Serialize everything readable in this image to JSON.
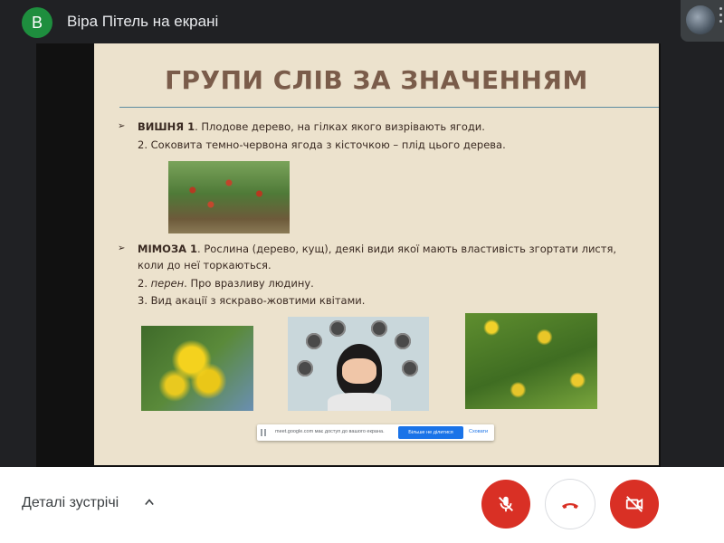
{
  "presenter": {
    "initial": "В",
    "title": "Віра Пітель на екрані"
  },
  "slide": {
    "title": "ГРУПИ СЛІВ ЗА ЗНАЧЕННЯМ",
    "entry1": {
      "term": "ВИШНЯ 1",
      "line1": ". Плодове дерево, на гілках якого визрівають ягоди.",
      "line2": "2. Соковита темно-червона ягода з кісточкою – плід цього дерева."
    },
    "entry2": {
      "term": "МІМОЗА 1",
      "line1": ". Рослина (дерево, кущ), деякі види якої мають властивість згортати листя,",
      "line1b": "коли до неї торкаються.",
      "line2_num": "2. ",
      "line2_italic": "перен",
      "line2_rest": ". Про вразливу людину.",
      "line3": "3. Вид акації з яскраво-жовтими квітами."
    }
  },
  "share_notice": {
    "text": "meet.google.com має доступ до вашого екрана.",
    "stop_label": "Більше не ділитися",
    "hide_label": "Сховати"
  },
  "bottom": {
    "details_label": "Деталі зустрічі"
  },
  "colors": {
    "danger": "#d93025",
    "presenter_avatar": "#1e8e3e",
    "background": "#202124"
  },
  "icons": {
    "mic": "mic-off-icon",
    "hangup": "call-end-icon",
    "cam": "videocam-off-icon"
  }
}
